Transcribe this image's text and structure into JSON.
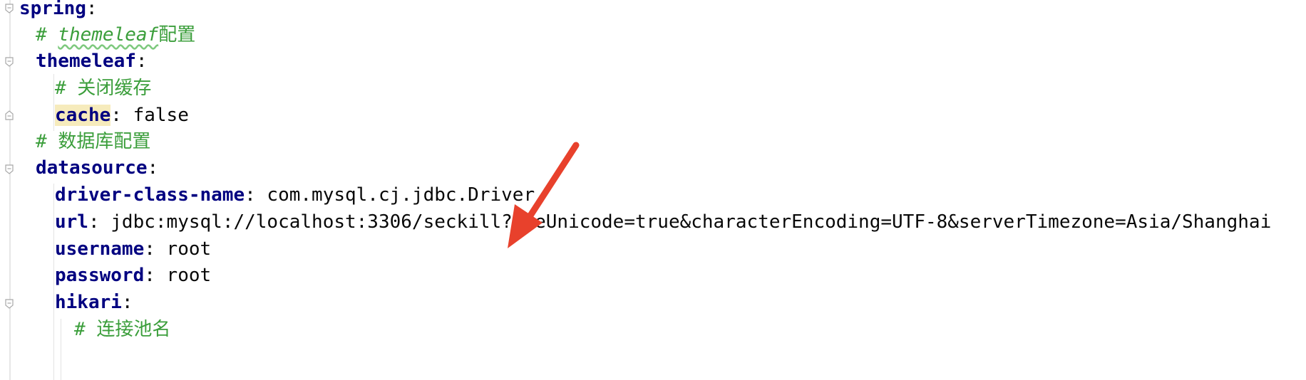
{
  "editor": {
    "lines": [
      {
        "key": "spring",
        "sep": ":",
        "value": ""
      },
      {
        "comment_prefix": "# ",
        "comment_word": "themeleaf",
        "comment_rest": "配置"
      },
      {
        "key": "themeleaf",
        "sep": ":",
        "value": ""
      },
      {
        "comment_prefix": "# ",
        "comment_rest": "关闭缓存"
      },
      {
        "key": "cache",
        "sep": ": ",
        "value": "false"
      },
      {
        "comment_prefix": "# ",
        "comment_rest": "数据库配置"
      },
      {
        "key": "datasource",
        "sep": ":",
        "value": ""
      },
      {
        "key": "driver-class-name",
        "sep": ": ",
        "value": "com.mysql.cj.jdbc.Driver"
      },
      {
        "key": "url",
        "sep": ": ",
        "value": "jdbc:mysql://localhost:3306/seckill?useUnicode=true&characterEncoding=UTF-8&serverTimezone=Asia/Shanghai"
      },
      {
        "key": "username",
        "sep": ": ",
        "value": "root"
      },
      {
        "key": "password",
        "sep": ": ",
        "value": "root"
      },
      {
        "key": "hikari",
        "sep": ":",
        "value": ""
      },
      {
        "comment_prefix": "# ",
        "comment_rest": "连接池名"
      }
    ]
  },
  "colors": {
    "key": "#000080",
    "comment": "#3b9e3b",
    "highlight": "#f6ebbc",
    "arrow": "#e8412c"
  },
  "annotation": {
    "icon": "red-arrow-icon"
  }
}
